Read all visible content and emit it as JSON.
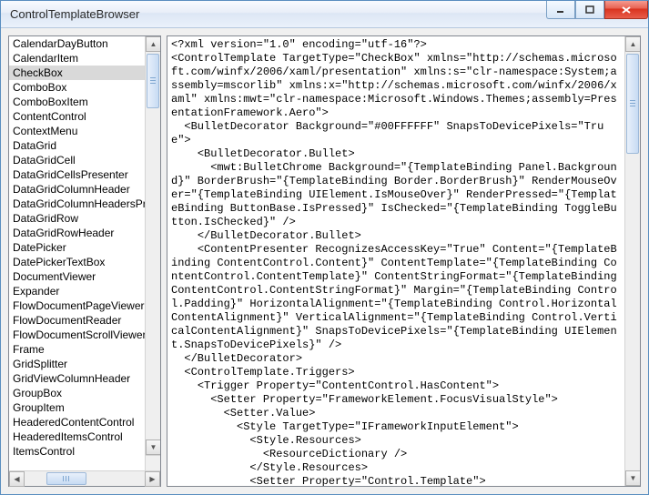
{
  "window": {
    "title": "ControlTemplateBrowser"
  },
  "list": {
    "selected_index": 2,
    "items": [
      "CalendarDayButton",
      "CalendarItem",
      "CheckBox",
      "ComboBox",
      "ComboBoxItem",
      "ContentControl",
      "ContextMenu",
      "DataGrid",
      "DataGridCell",
      "DataGridCellsPresenter",
      "DataGridColumnHeader",
      "DataGridColumnHeadersPresenter",
      "DataGridRow",
      "DataGridRowHeader",
      "DatePicker",
      "DatePickerTextBox",
      "DocumentViewer",
      "Expander",
      "FlowDocumentPageViewer",
      "FlowDocumentReader",
      "FlowDocumentScrollViewer",
      "Frame",
      "GridSplitter",
      "GridViewColumnHeader",
      "GroupBox",
      "GroupItem",
      "HeaderedContentControl",
      "HeaderedItemsControl",
      "ItemsControl"
    ]
  },
  "xml": "<?xml version=\"1.0\" encoding=\"utf-16\"?>\n<ControlTemplate TargetType=\"CheckBox\" xmlns=\"http://schemas.microsoft.com/winfx/2006/xaml/presentation\" xmlns:s=\"clr-namespace:System;assembly=mscorlib\" xmlns:x=\"http://schemas.microsoft.com/winfx/2006/xaml\" xmlns:mwt=\"clr-namespace:Microsoft.Windows.Themes;assembly=PresentationFramework.Aero\">\n  <BulletDecorator Background=\"#00FFFFFF\" SnapsToDevicePixels=\"True\">\n    <BulletDecorator.Bullet>\n      <mwt:BulletChrome Background=\"{TemplateBinding Panel.Background}\" BorderBrush=\"{TemplateBinding Border.BorderBrush}\" RenderMouseOver=\"{TemplateBinding UIElement.IsMouseOver}\" RenderPressed=\"{TemplateBinding ButtonBase.IsPressed}\" IsChecked=\"{TemplateBinding ToggleButton.IsChecked}\" />\n    </BulletDecorator.Bullet>\n    <ContentPresenter RecognizesAccessKey=\"True\" Content=\"{TemplateBinding ContentControl.Content}\" ContentTemplate=\"{TemplateBinding ContentControl.ContentTemplate}\" ContentStringFormat=\"{TemplateBinding ContentControl.ContentStringFormat}\" Margin=\"{TemplateBinding Control.Padding}\" HorizontalAlignment=\"{TemplateBinding Control.HorizontalContentAlignment}\" VerticalAlignment=\"{TemplateBinding Control.VerticalContentAlignment}\" SnapsToDevicePixels=\"{TemplateBinding UIElement.SnapsToDevicePixels}\" />\n  </BulletDecorator>\n  <ControlTemplate.Triggers>\n    <Trigger Property=\"ContentControl.HasContent\">\n      <Setter Property=\"FrameworkElement.FocusVisualStyle\">\n        <Setter.Value>\n          <Style TargetType=\"IFrameworkInputElement\">\n            <Style.Resources>\n              <ResourceDictionary />\n            </Style.Resources>\n            <Setter Property=\"Control.Template\">\n              <Setter.Value>"
}
